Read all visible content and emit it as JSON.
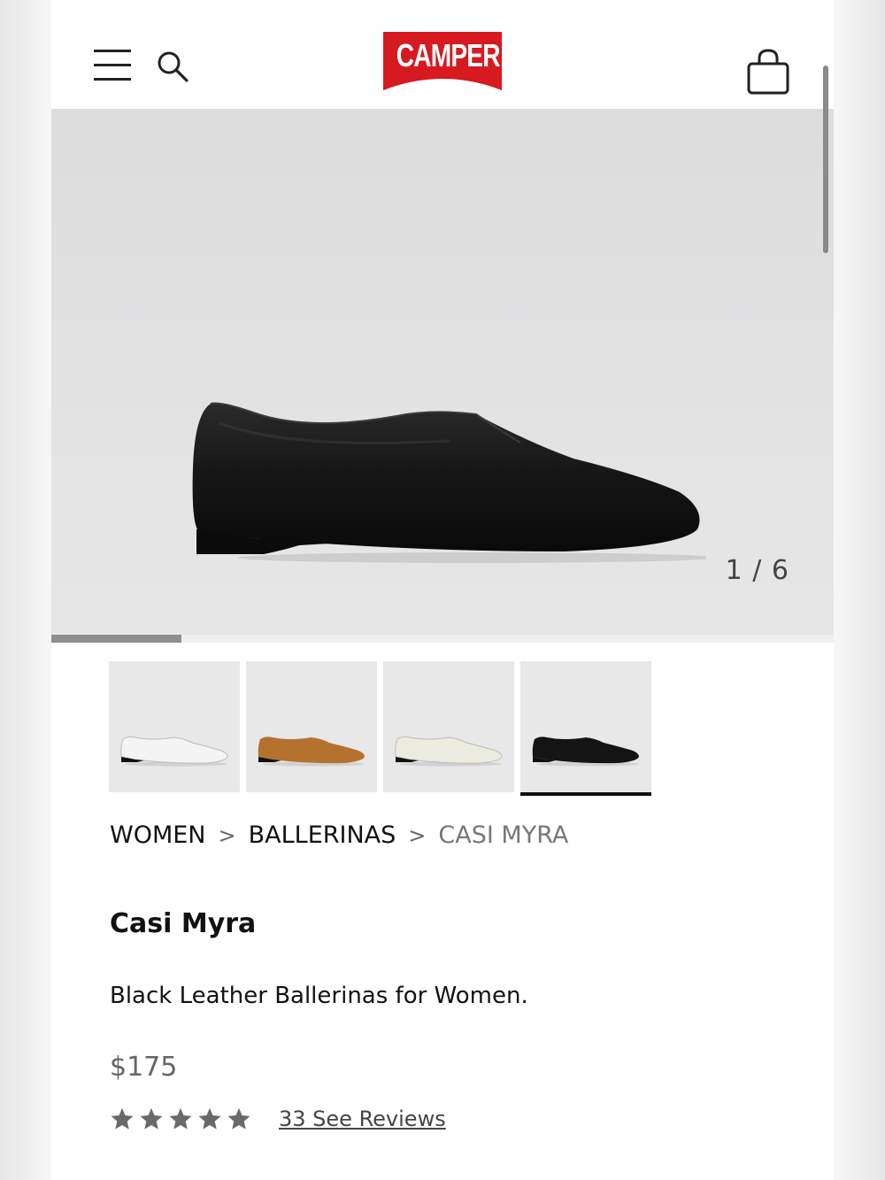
{
  "header": {
    "brand": "CAMPER",
    "brand_color": "#d71920"
  },
  "gallery": {
    "counter": "1 / 6",
    "current_index": 1,
    "total": 6,
    "progress_fraction": 0.1667
  },
  "thumbnails": [
    {
      "color_name": "white",
      "shoe_color": "#f4f4f4"
    },
    {
      "color_name": "brown",
      "shoe_color": "#b5722e"
    },
    {
      "color_name": "cream",
      "shoe_color": "#ecebe0"
    },
    {
      "color_name": "black",
      "shoe_color": "#141414",
      "selected": true
    }
  ],
  "breadcrumb": {
    "items": [
      "WOMEN",
      "BALLERINAS",
      "CASI MYRA"
    ],
    "separator": ">"
  },
  "product": {
    "title": "Casi Myra",
    "description": "Black Leather Ballerinas for Women.",
    "price": "$175",
    "rating_stars": 5,
    "reviews_link": "33 See Reviews"
  }
}
